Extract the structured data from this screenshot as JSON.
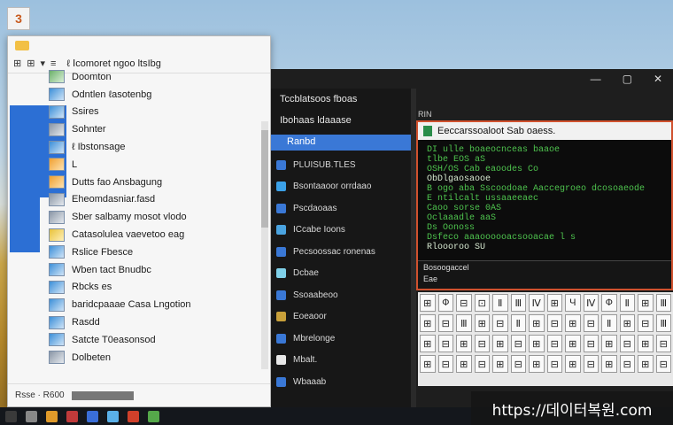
{
  "desktop": {
    "icon_glyph": "3"
  },
  "explorer": {
    "toolbar_glyphs": [
      "⊞",
      "⊞",
      "▾",
      "≡"
    ],
    "path": "ℓ Ⅰcomoret ngoo ltsIbg",
    "items": [
      {
        "label": "Doomton",
        "icon": "green"
      },
      {
        "label": "Odntlen ℓasotenbg",
        "icon": "blue"
      },
      {
        "label": "Ssires",
        "icon": "blue"
      },
      {
        "label": "Sohnter",
        "icon": "gray"
      },
      {
        "label": "ℓ Ibstonsage",
        "icon": "blue"
      },
      {
        "label": "L",
        "icon": "orange"
      },
      {
        "label": "Dutts fao Ansbagung",
        "icon": "orange"
      },
      {
        "label": "Eheomdasniar.fasd",
        "icon": "gray"
      },
      {
        "label": "Sber salbamy mosot vlodo",
        "icon": "gray"
      },
      {
        "label": "Catasolulea vaevetoo eag",
        "icon": "yellow"
      },
      {
        "label": "Rslice Fbesce",
        "icon": "blue"
      },
      {
        "label": "Wben tact Bnudbc",
        "icon": "blue"
      },
      {
        "label": "Rbcks es",
        "icon": "blue"
      },
      {
        "label": "baridcpaaae Casa Lngotion",
        "icon": "blue"
      },
      {
        "label": "Rasdd",
        "icon": "blue"
      },
      {
        "label": "Satcte T0easonsod",
        "icon": "blue"
      },
      {
        "label": "Dolbeten",
        "icon": "gray"
      }
    ],
    "status_text": "Rsse · R600"
  },
  "dark": {
    "controls": [
      "—",
      "▢",
      "✕"
    ],
    "sidebar_header": "Tccblatsoos fboas",
    "sidebar_subheader": "Ibohaas ldaaase",
    "selected": "Ranbd",
    "items": [
      {
        "label": "PLUISUB.TLES",
        "color": "#3a78d6"
      },
      {
        "label": "Bsontaaoor orrdaao",
        "color": "#3ba1e8"
      },
      {
        "label": "Pscdaoaas",
        "color": "#3a78d6"
      },
      {
        "label": "ICcabe Ioons",
        "color": "#4aa3e0"
      },
      {
        "label": "Pecsoossac ronenas",
        "color": "#3a78d6"
      },
      {
        "label": "Dcbae",
        "color": "#7fd0e8"
      },
      {
        "label": "Ssoaabeoo",
        "color": "#3a78d6"
      },
      {
        "label": "Eoeaoor",
        "color": "#c8a03a"
      },
      {
        "label": "Mbrelonge",
        "color": "#3a78d6"
      },
      {
        "label": "Mbalt.",
        "color": "#e8e8e8"
      },
      {
        "label": "Wbaaab",
        "color": "#3a78d6"
      }
    ],
    "tab_label": "RIN"
  },
  "terminal": {
    "title": "Eeccarssoaloot Sab oaess.",
    "lines": [
      {
        "t": "DI  ulle boaeocnceas baaoe",
        "c": "g"
      },
      {
        "t": "tlbe EOS aS",
        "c": "g"
      },
      {
        "t": "OSH/OS Cab  eaoodes Co",
        "c": "g"
      },
      {
        "t": "ObDlgaosaooe",
        "c": "w"
      },
      {
        "t": "B ogo aba Sscoodoae  Aaccegroeo dcosoaeode",
        "c": "g"
      },
      {
        "t": "E ntilcalt ussaaeeaec",
        "c": "g"
      },
      {
        "t": "Caoo sorse 0AS",
        "c": "g"
      },
      {
        "t": "Oclaaadle aaS",
        "c": "g"
      },
      {
        "t": "Ds Oonoss",
        "c": "g"
      },
      {
        "t": "Dsfeco aaaoooooacsooacae l s",
        "c": "g"
      },
      {
        "t": "Rloooroo SU",
        "c": "w"
      }
    ],
    "footer": [
      "Bosoogaccel",
      "Eae"
    ]
  },
  "keys": {
    "row1": [
      "⊞",
      "Ф",
      "⊟",
      "⊡",
      "Ⅱ",
      "Ⅲ",
      "Ⅳ",
      "⊞",
      "Ч",
      "Ⅳ",
      "Ф",
      "Ⅱ",
      "⊞",
      "Ⅲ"
    ],
    "row2": [
      "⊞",
      "⊟",
      "Ⅲ",
      "⊞",
      "⊟",
      "Ⅱ",
      "⊞",
      "⊟",
      "⊞",
      "⊟",
      "Ⅱ",
      "⊞",
      "⊟",
      "Ⅲ"
    ],
    "row3": [
      "⊞",
      "⊟",
      "⊞",
      "⊟",
      "⊞",
      "⊟",
      "⊞",
      "⊟",
      "⊞",
      "⊟",
      "⊞",
      "⊟",
      "⊞",
      "⊟"
    ],
    "row4": [
      "⊞",
      "⊟",
      "⊞",
      "⊟",
      "⊞",
      "⊟",
      "⊞",
      "⊟",
      "⊞",
      "⊟",
      "⊞",
      "⊟",
      "⊞",
      "⊟"
    ]
  },
  "taskbar": {
    "icons": [
      "#3a3a3a",
      "#888",
      "#e09a2a",
      "#c03a3a",
      "#3a6ed8",
      "#5ab0e8",
      "#d0402a",
      "#55a84a"
    ]
  },
  "watermark": "https://데이터복원.com"
}
